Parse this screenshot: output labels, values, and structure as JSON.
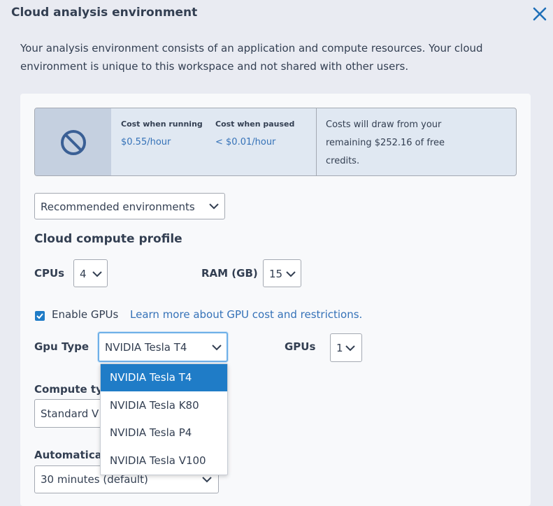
{
  "header": {
    "title": "Cloud analysis environment"
  },
  "intro": "Your analysis environment consists of an application and compute resources. Your cloud environment is unique to this workspace and not shared with other users.",
  "cost": {
    "running_label": "Cost when running",
    "running_value": "$0.55/hour",
    "paused_label": "Cost when paused",
    "paused_value": "< $0.01/hour",
    "note": "Costs will draw from your remaining $252.16 of free credits."
  },
  "environment_select": {
    "value": "Recommended environments"
  },
  "compute_profile": {
    "title": "Cloud compute profile",
    "cpus_label": "CPUs",
    "cpus_value": "4",
    "ram_label": "RAM (GB)",
    "ram_value": "15"
  },
  "gpu": {
    "enabled": true,
    "enable_label": "Enable GPUs",
    "learn_more": "Learn more about GPU cost and restrictions.",
    "type_label": "Gpu Type",
    "type_value": "NVIDIA Tesla T4",
    "count_label": "GPUs",
    "count_value": "1",
    "options": [
      "NVIDIA Tesla T4",
      "NVIDIA Tesla K80",
      "NVIDIA Tesla P4",
      "NVIDIA Tesla V100"
    ]
  },
  "compute_type": {
    "label": "Compute ty",
    "value": "Standard V"
  },
  "auto_pause": {
    "label": "Automatica",
    "value": "30 minutes (default)"
  },
  "colors": {
    "accent": "#1f7cc7",
    "link": "#3572b8",
    "text": "#333f52",
    "background": "#e9ebf2"
  }
}
